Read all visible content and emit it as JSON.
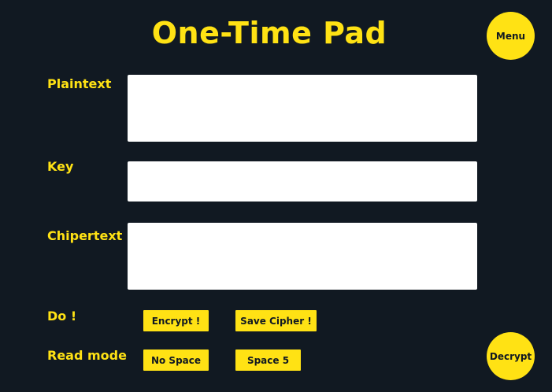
{
  "app": {
    "title": "One-Time Pad"
  },
  "nav": {
    "menu_label": "Menu",
    "decrypt_label": "Decrypt"
  },
  "fields": {
    "plaintext": {
      "label": "Plaintext",
      "value": "",
      "placeholder": ""
    },
    "key": {
      "label": "Key",
      "value": "",
      "placeholder": ""
    },
    "ciphertext": {
      "label": "Chipertext",
      "value": "",
      "placeholder": ""
    }
  },
  "actions": {
    "label": "Do !",
    "encrypt_label": "Encrypt !",
    "save_cipher_label": "Save Cipher !"
  },
  "read_mode": {
    "label": "Read mode",
    "no_space_label": "No Space",
    "space5_label": "Space 5"
  },
  "colors": {
    "background": "#111922",
    "accent": "#FFE214",
    "field": "#FFFFFF"
  }
}
